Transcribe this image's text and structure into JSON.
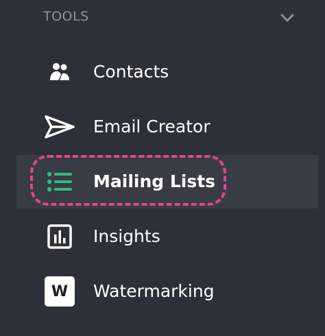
{
  "section": {
    "title": "TOOLS",
    "toggle_icon": "chevron-down-icon"
  },
  "nav": {
    "items": [
      {
        "label": "Contacts",
        "icon": "contacts-icon",
        "active": false
      },
      {
        "label": "Email Creator",
        "icon": "paper-plane-icon",
        "active": false
      },
      {
        "label": "Mailing Lists",
        "icon": "list-icon",
        "active": true
      },
      {
        "label": "Insights",
        "icon": "bar-chart-icon",
        "active": false
      },
      {
        "label": "Watermarking",
        "icon": "watermark-w-icon",
        "active": false,
        "icon_text": "W"
      }
    ]
  },
  "colors": {
    "background": "#2c3038",
    "active_background": "#383c45",
    "text": "#ffffff",
    "muted_text": "#8d949c",
    "accent_green": "#2ebd85",
    "highlight_outline": "#e0458f"
  }
}
